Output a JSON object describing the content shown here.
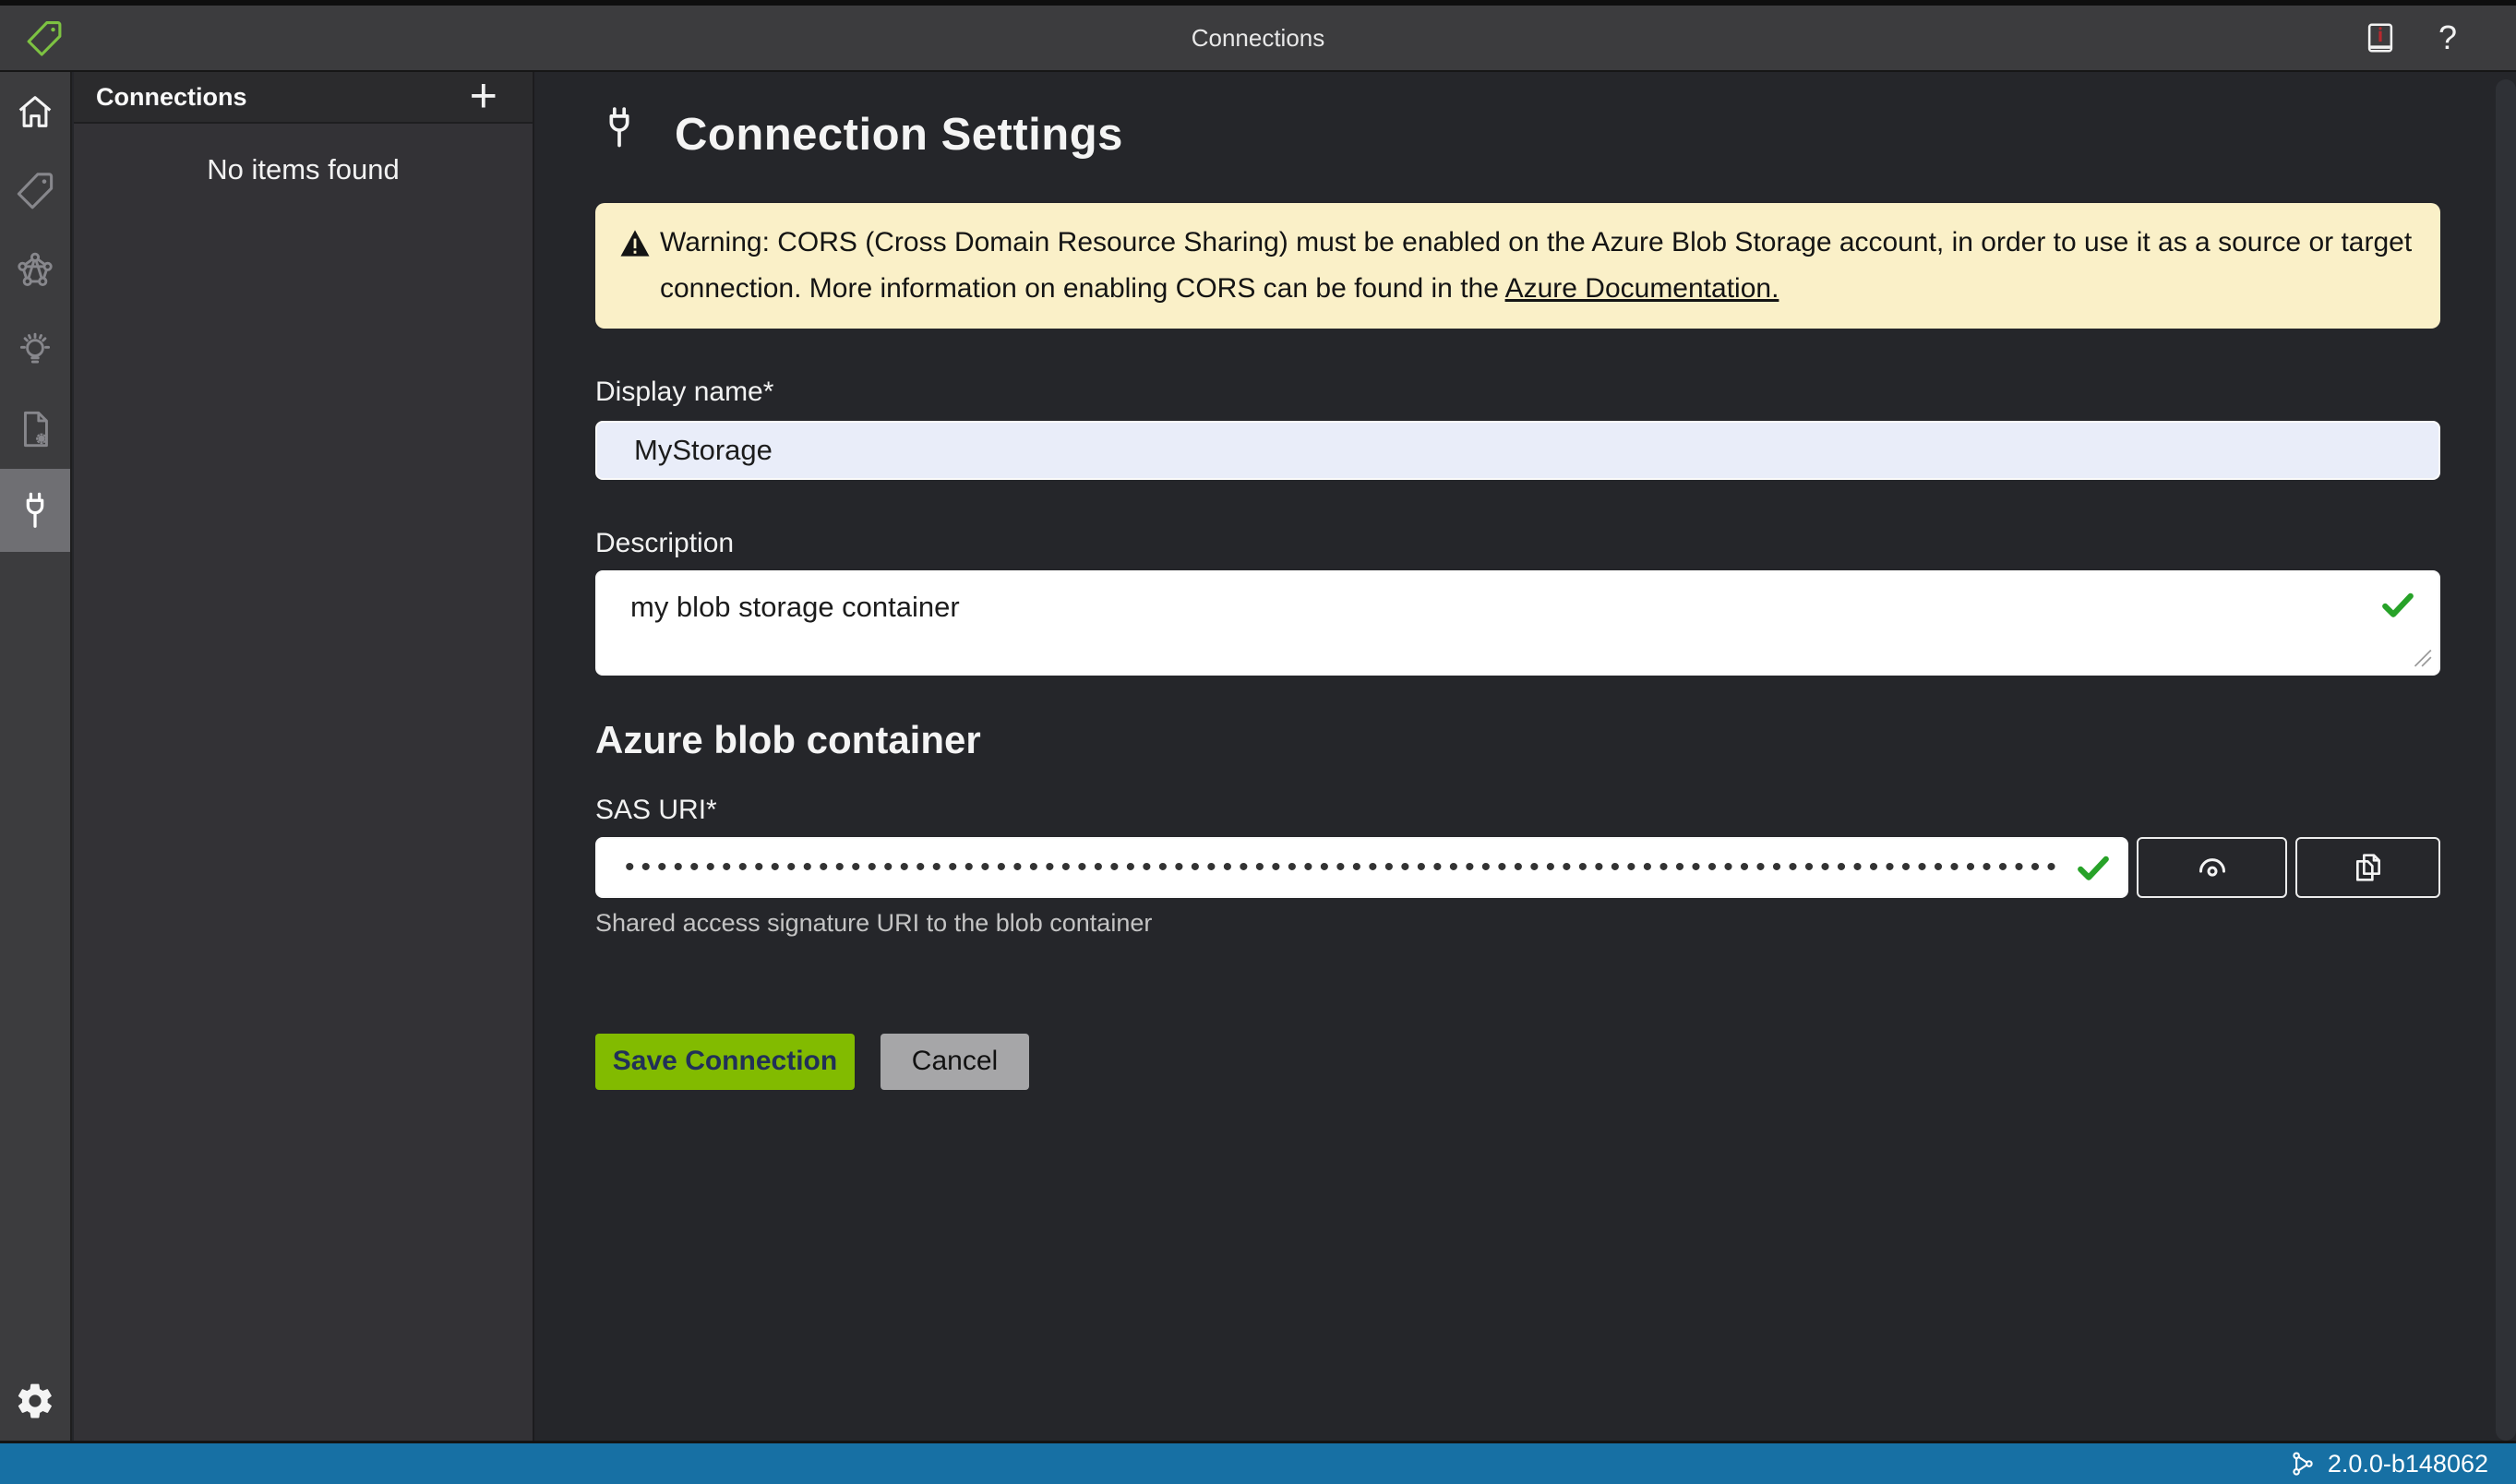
{
  "titlebar": {
    "title": "Connections",
    "help_label": "?"
  },
  "nav_rail": {
    "items": [
      {
        "icon": "home-icon",
        "selected": false
      },
      {
        "icon": "tag-icon",
        "selected": false
      },
      {
        "icon": "network-graph-icon",
        "selected": false
      },
      {
        "icon": "lightbulb-icon",
        "selected": false
      },
      {
        "icon": "document-gear-icon",
        "selected": false
      },
      {
        "icon": "plug-icon",
        "selected": true
      }
    ],
    "bottom_icon": "settings-gear-icon"
  },
  "panel": {
    "title": "Connections",
    "add_button": "+",
    "empty_message": "No items found"
  },
  "main": {
    "title": "Connection Settings",
    "warning": {
      "line1": "Warning: CORS (Cross Domain Resource Sharing) must be enabled on the Azure Blob Storage account, in order to use it as a source or target connection. More information on enabling CORS can be found in the ",
      "link_text": "Azure Documentation."
    },
    "display_name": {
      "label": "Display name*",
      "value": "MyStorage"
    },
    "description": {
      "label": "Description",
      "value": "my blob storage container"
    },
    "section_title": "Azure blob container",
    "sas_uri": {
      "label": "SAS URI*",
      "value_masked": "••••••••••••••••••••••••••••••••••••••••••••••••••••••••••••••••••••••••••••••••••••••••••••••",
      "helper": "Shared access signature URI to the blob container"
    },
    "buttons": {
      "save": "Save Connection",
      "cancel": "Cancel"
    }
  },
  "statusbar": {
    "version": "2.0.0-b148062"
  },
  "colors": {
    "accent_green": "#82BB00",
    "logo_green": "#7DC242",
    "valid_check_green": "#27A228",
    "warning_bg": "#FAF0C8",
    "status_bar_blue": "#1770A4",
    "highlighted_input_bg": "#E9EDF9"
  }
}
